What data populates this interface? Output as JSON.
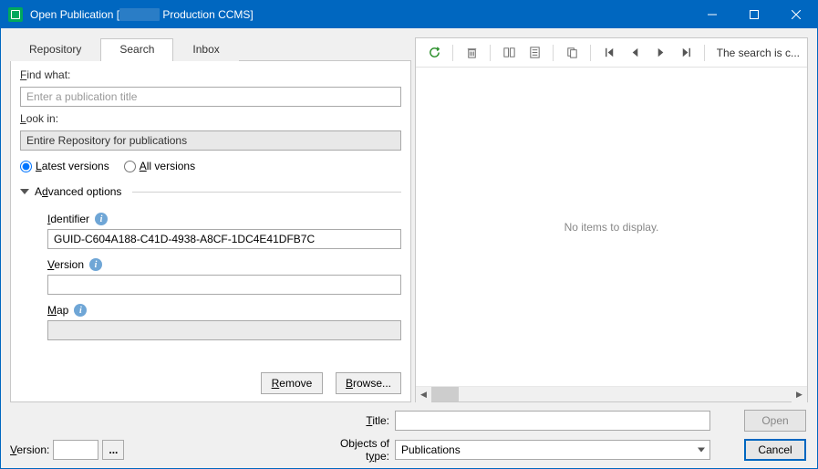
{
  "window": {
    "title_prefix": "Open Publication [",
    "title_suffix": " Production CCMS]"
  },
  "tabs": {
    "repository": "Repository",
    "search": "Search",
    "inbox": "Inbox"
  },
  "search_panel": {
    "find_label": "Find what:",
    "find_placeholder": "Enter a publication title",
    "lookin_label": "Look in:",
    "lookin_value": "Entire Repository for publications",
    "latest_versions": "Latest versions",
    "all_versions": "All versions",
    "advanced_label": "Advanced options",
    "identifier_label": "Identifier",
    "identifier_value": "GUID-C604A188-C41D-4938-A8CF-1DC4E41DFB7C",
    "version_label": "Version",
    "version_value": "",
    "map_label": "Map",
    "map_value": "",
    "remove_btn": "Remove",
    "browse_btn": "Browse..."
  },
  "results": {
    "status_text": "The search is c...",
    "empty_text": "No items to display."
  },
  "footer": {
    "version_label": "Version:",
    "ellipsis": "...",
    "title_label": "Title:",
    "title_value": "",
    "objects_label": "Objects of type:",
    "objects_value": "Publications",
    "open_btn": "Open",
    "cancel_btn": "Cancel"
  }
}
